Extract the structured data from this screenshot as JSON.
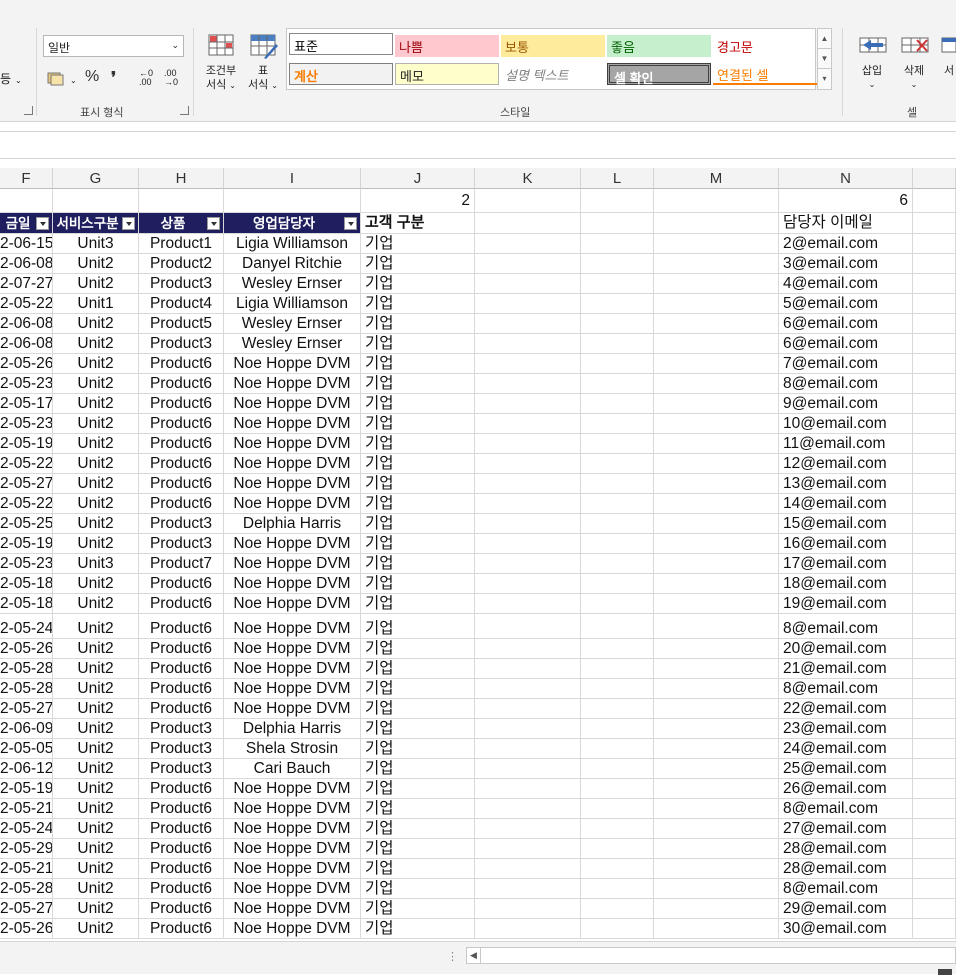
{
  "ribbon": {
    "number_format_value": "일반",
    "number_group_label": "표시 형식",
    "style_group_label": "스타일",
    "cells_group_label": "셀",
    "cond_format_label_1": "조건부",
    "cond_format_label_2": "서식",
    "table_format_label_1": "표",
    "table_format_label_2": "서식",
    "insert_label": "삽입",
    "delete_label": "삭제",
    "format_label_partial": "서",
    "left_partial": "등",
    "percent_glyph": "%",
    "comma_glyph": "❜",
    "dec_increase": "←0 .00",
    "dec_decrease": ".00 →0",
    "styles": [
      {
        "label": "표준"
      },
      {
        "label": "나쁨"
      },
      {
        "label": "보통"
      },
      {
        "label": "좋음"
      },
      {
        "label": "경고문"
      },
      {
        "label": "계산"
      },
      {
        "label": "메모"
      },
      {
        "label": "설명 텍스트"
      },
      {
        "label": "셀 확인"
      },
      {
        "label": "연결된 셀"
      }
    ],
    "colors": {
      "bad_bg": "#ffc7ce",
      "bad_fg": "#9c0006",
      "neutral_bg": "#ffeb9c",
      "neutral_fg": "#9c5700",
      "good_bg": "#c6efce",
      "good_fg": "#006100",
      "warning_fg": "#c00000",
      "calc_fg": "#fa7d00",
      "note_bg": "#ffffcc",
      "check_bg": "#a5a5a5",
      "linked_fg": "#fa7d00",
      "header_bg": "#1f1f5f"
    }
  },
  "columns": [
    {
      "letter": "F"
    },
    {
      "letter": "G"
    },
    {
      "letter": "H"
    },
    {
      "letter": "I"
    },
    {
      "letter": "J"
    },
    {
      "letter": "K"
    },
    {
      "letter": "L"
    },
    {
      "letter": "M"
    },
    {
      "letter": "N"
    }
  ],
  "top_row": {
    "j_value": "2",
    "n_value": "6"
  },
  "headers": {
    "f": "금일",
    "g": "서비스구분",
    "h": "상품",
    "i": "영업담당자",
    "j": "고객 구분",
    "n": "담당자 이메일"
  },
  "rows": [
    [
      "2-06-15",
      "Unit3",
      "Product1",
      "Ligia Williamson",
      "기업",
      "2@email.com"
    ],
    [
      "2-06-08",
      "Unit2",
      "Product2",
      "Danyel Ritchie",
      "기업",
      "3@email.com"
    ],
    [
      "2-07-27",
      "Unit2",
      "Product3",
      "Wesley Ernser",
      "기업",
      "4@email.com"
    ],
    [
      "2-05-22",
      "Unit1",
      "Product4",
      "Ligia Williamson",
      "기업",
      "5@email.com"
    ],
    [
      "2-06-08",
      "Unit2",
      "Product5",
      "Wesley Ernser",
      "기업",
      "6@email.com"
    ],
    [
      "2-06-08",
      "Unit2",
      "Product3",
      "Wesley Ernser",
      "기업",
      "6@email.com"
    ],
    [
      "2-05-26",
      "Unit2",
      "Product6",
      "Noe Hoppe DVM",
      "기업",
      "7@email.com"
    ],
    [
      "2-05-23",
      "Unit2",
      "Product6",
      "Noe Hoppe DVM",
      "기업",
      "8@email.com"
    ],
    [
      "2-05-17",
      "Unit2",
      "Product6",
      "Noe Hoppe DVM",
      "기업",
      "9@email.com"
    ],
    [
      "2-05-23",
      "Unit2",
      "Product6",
      "Noe Hoppe DVM",
      "기업",
      "10@email.com"
    ],
    [
      "2-05-19",
      "Unit2",
      "Product6",
      "Noe Hoppe DVM",
      "기업",
      "11@email.com"
    ],
    [
      "2-05-22",
      "Unit2",
      "Product6",
      "Noe Hoppe DVM",
      "기업",
      "12@email.com"
    ],
    [
      "2-05-27",
      "Unit2",
      "Product6",
      "Noe Hoppe DVM",
      "기업",
      "13@email.com"
    ],
    [
      "2-05-22",
      "Unit2",
      "Product6",
      "Noe Hoppe DVM",
      "기업",
      "14@email.com"
    ],
    [
      "2-05-25",
      "Unit2",
      "Product3",
      "Delphia Harris",
      "기업",
      "15@email.com"
    ],
    [
      "2-05-19",
      "Unit2",
      "Product3",
      "Noe Hoppe DVM",
      "기업",
      "16@email.com"
    ],
    [
      "2-05-23",
      "Unit3",
      "Product7",
      "Noe Hoppe DVM",
      "기업",
      "17@email.com"
    ],
    [
      "2-05-18",
      "Unit2",
      "Product6",
      "Noe Hoppe DVM",
      "기업",
      "18@email.com"
    ],
    [
      "2-05-18",
      "Unit2",
      "Product6",
      "Noe Hoppe DVM",
      "기업",
      "19@email.com"
    ],
    [
      "2-05-24",
      "Unit2",
      "Product6",
      "Noe Hoppe DVM",
      "기업",
      "8@email.com"
    ],
    [
      "2-05-26",
      "Unit2",
      "Product6",
      "Noe Hoppe DVM",
      "기업",
      "20@email.com"
    ],
    [
      "2-05-28",
      "Unit2",
      "Product6",
      "Noe Hoppe DVM",
      "기업",
      "21@email.com"
    ],
    [
      "2-05-28",
      "Unit2",
      "Product6",
      "Noe Hoppe DVM",
      "기업",
      "8@email.com"
    ],
    [
      "2-05-27",
      "Unit2",
      "Product6",
      "Noe Hoppe DVM",
      "기업",
      "22@email.com"
    ],
    [
      "2-06-09",
      "Unit2",
      "Product3",
      "Delphia Harris",
      "기업",
      "23@email.com"
    ],
    [
      "2-05-05",
      "Unit2",
      "Product3",
      "Shela Strosin",
      "기업",
      "24@email.com"
    ],
    [
      "2-06-12",
      "Unit2",
      "Product3",
      "Cari Bauch",
      "기업",
      "25@email.com"
    ],
    [
      "2-05-19",
      "Unit2",
      "Product6",
      "Noe Hoppe DVM",
      "기업",
      "26@email.com"
    ],
    [
      "2-05-21",
      "Unit2",
      "Product6",
      "Noe Hoppe DVM",
      "기업",
      "8@email.com"
    ],
    [
      "2-05-24",
      "Unit2",
      "Product6",
      "Noe Hoppe DVM",
      "기업",
      "27@email.com"
    ],
    [
      "2-05-29",
      "Unit2",
      "Product6",
      "Noe Hoppe DVM",
      "기업",
      "28@email.com"
    ],
    [
      "2-05-21",
      "Unit2",
      "Product6",
      "Noe Hoppe DVM",
      "기업",
      "28@email.com"
    ],
    [
      "2-05-28",
      "Unit2",
      "Product6",
      "Noe Hoppe DVM",
      "기업",
      "8@email.com"
    ],
    [
      "2-05-27",
      "Unit2",
      "Product6",
      "Noe Hoppe DVM",
      "기업",
      "29@email.com"
    ],
    [
      "2-05-26",
      "Unit2",
      "Product6",
      "Noe Hoppe DVM",
      "기업",
      "30@email.com"
    ]
  ]
}
